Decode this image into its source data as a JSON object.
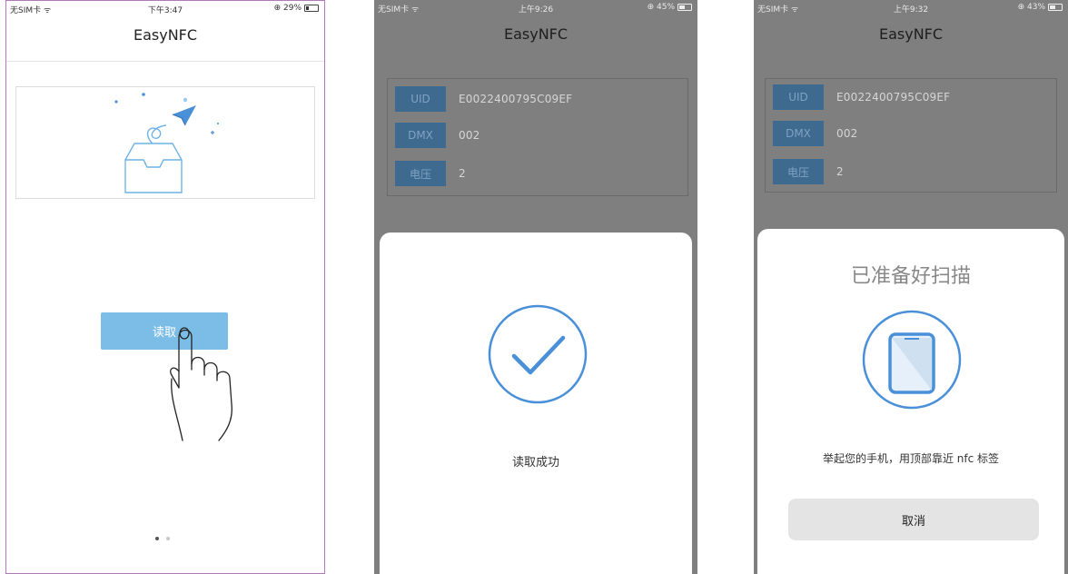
{
  "screens": [
    {
      "status": {
        "carrier": "无SIM卡 ᯤ",
        "time": "下午3:47",
        "battery": "⊕ 29%",
        "battery_level": 0.29
      },
      "nav_title": "EasyNFC",
      "read_button": "读取",
      "pager": {
        "pages": 2,
        "current": 1
      }
    },
    {
      "status": {
        "carrier": "无SIM卡 ᯤ",
        "time": "上午9:26",
        "battery": "⊕ 45%",
        "battery_level": 0.45
      },
      "nav_title": "EasyNFC",
      "info": [
        {
          "label": "UID",
          "value": "E0022400795C09EF"
        },
        {
          "label": "DMX",
          "value": "002"
        },
        {
          "label": "电压",
          "value": "2"
        }
      ],
      "sheet_text": "读取成功"
    },
    {
      "status": {
        "carrier": "无SIM卡 ᯤ",
        "time": "上午9:32",
        "battery": "⊕ 43%",
        "battery_level": 0.43
      },
      "nav_title": "EasyNFC",
      "info": [
        {
          "label": "UID",
          "value": "E0022400795C09EF"
        },
        {
          "label": "DMX",
          "value": "002"
        },
        {
          "label": "电压",
          "value": "2"
        }
      ],
      "sheet_title": "已准备好扫描",
      "sheet_hint": "举起您的手机，用顶部靠近 nfc 标签",
      "cancel_button": "取消"
    }
  ],
  "colors": {
    "accent": "#7cbde8",
    "icon_blue": "#4a90d9",
    "overlay": "#7f7f7f"
  }
}
